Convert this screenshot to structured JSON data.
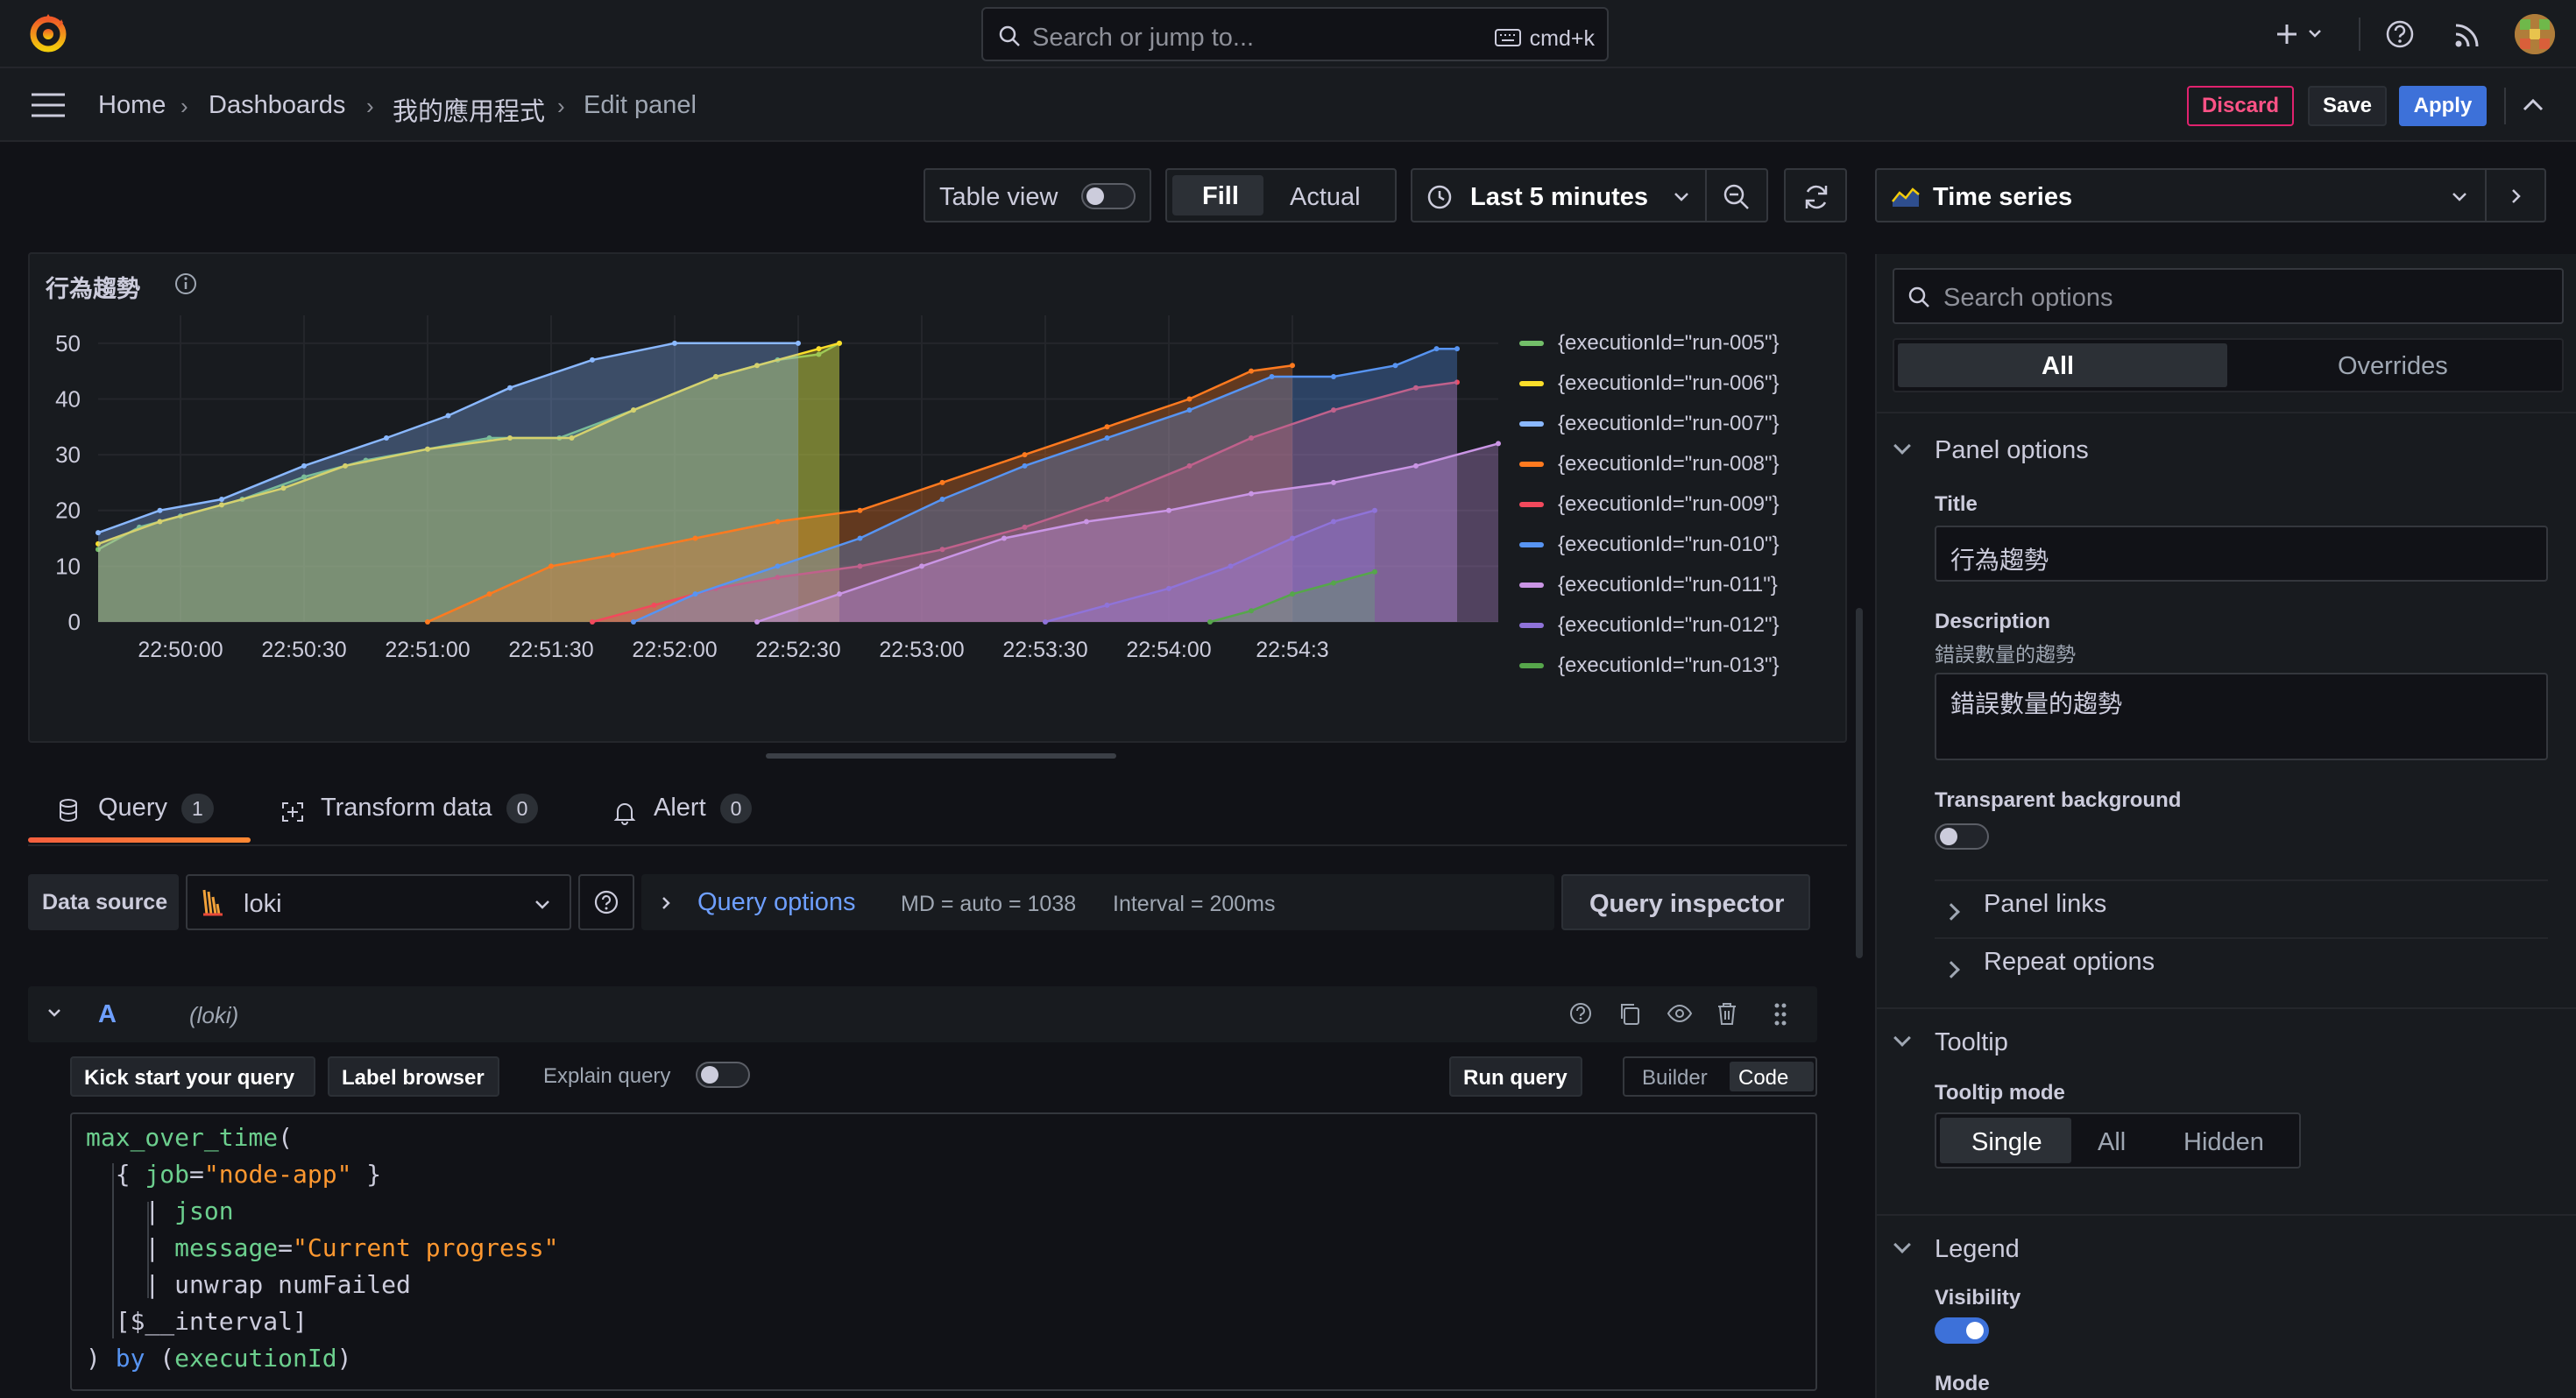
{
  "topbar": {
    "search_placeholder": "Search or jump to...",
    "search_shortcut": "cmd+k"
  },
  "breadcrumb": [
    "Home",
    "Dashboards",
    "我的應用程式",
    "Edit panel"
  ],
  "actions": {
    "discard": "Discard",
    "save": "Save",
    "apply": "Apply"
  },
  "toolbar": {
    "table_view": "Table view",
    "fill": "Fill",
    "actual": "Actual",
    "time_range": "Last 5 minutes",
    "visualization": "Time series"
  },
  "panel": {
    "title": "行為趨勢"
  },
  "chart_data": {
    "type": "area",
    "title": "行為趨勢",
    "ylim": [
      0,
      55
    ],
    "yticks": [
      "0",
      "10",
      "20",
      "30",
      "40",
      "50"
    ],
    "xticks": [
      "22:50:00",
      "22:50:30",
      "22:51:00",
      "22:51:30",
      "22:52:00",
      "22:52:30",
      "22:53:00",
      "22:53:30",
      "22:54:00",
      "22:54:3"
    ],
    "x_range_seconds_from_22_49_40": [
      0,
      290
    ],
    "series": [
      {
        "name": "{executionId=\"run-005\"}",
        "color": "#73bf69",
        "points": [
          [
            0,
            13
          ],
          [
            10,
            17
          ],
          [
            20,
            19
          ],
          [
            35,
            22
          ],
          [
            50,
            26
          ],
          [
            65,
            29
          ],
          [
            80,
            31
          ],
          [
            95,
            33
          ],
          [
            112,
            33
          ],
          [
            130,
            38
          ],
          [
            150,
            44
          ],
          [
            165,
            47
          ],
          [
            175,
            48
          ],
          [
            180,
            50
          ]
        ]
      },
      {
        "name": "{executionId=\"run-006\"}",
        "color": "#fade2a",
        "points": [
          [
            0,
            14
          ],
          [
            15,
            18
          ],
          [
            30,
            21
          ],
          [
            45,
            24
          ],
          [
            60,
            28
          ],
          [
            80,
            31
          ],
          [
            100,
            33
          ],
          [
            115,
            33
          ],
          [
            130,
            38
          ],
          [
            150,
            44
          ],
          [
            160,
            46
          ],
          [
            175,
            49
          ],
          [
            180,
            50
          ]
        ]
      },
      {
        "name": "{executionId=\"run-007\"}",
        "color": "#8ab8ff",
        "points": [
          [
            0,
            16
          ],
          [
            15,
            20
          ],
          [
            30,
            22
          ],
          [
            50,
            28
          ],
          [
            70,
            33
          ],
          [
            85,
            37
          ],
          [
            100,
            42
          ],
          [
            120,
            47
          ],
          [
            140,
            50
          ],
          [
            170,
            50
          ]
        ]
      },
      {
        "name": "{executionId=\"run-008\"}",
        "color": "#ff7a1f",
        "points": [
          [
            80,
            0
          ],
          [
            95,
            5
          ],
          [
            110,
            10
          ],
          [
            125,
            12
          ],
          [
            145,
            15
          ],
          [
            165,
            18
          ],
          [
            185,
            20
          ],
          [
            205,
            25
          ],
          [
            225,
            30
          ],
          [
            245,
            35
          ],
          [
            265,
            40
          ],
          [
            280,
            45
          ],
          [
            290,
            46
          ]
        ]
      },
      {
        "name": "{executionId=\"run-009\"}",
        "color": "#f2495c",
        "points": [
          [
            120,
            0
          ],
          [
            135,
            3
          ],
          [
            150,
            6
          ],
          [
            165,
            8
          ],
          [
            185,
            10
          ],
          [
            205,
            13
          ],
          [
            225,
            17
          ],
          [
            245,
            22
          ],
          [
            265,
            28
          ],
          [
            280,
            33
          ],
          [
            300,
            38
          ],
          [
            320,
            42
          ],
          [
            330,
            43
          ]
        ]
      },
      {
        "name": "{executionId=\"run-010\"}",
        "color": "#5794f2",
        "points": [
          [
            130,
            0
          ],
          [
            145,
            5
          ],
          [
            165,
            10
          ],
          [
            185,
            15
          ],
          [
            205,
            22
          ],
          [
            225,
            28
          ],
          [
            245,
            33
          ],
          [
            265,
            38
          ],
          [
            285,
            44
          ],
          [
            300,
            44
          ],
          [
            315,
            46
          ],
          [
            325,
            49
          ],
          [
            330,
            49
          ]
        ]
      },
      {
        "name": "{executionId=\"run-011\"}",
        "color": "#ca95e5",
        "points": [
          [
            160,
            0
          ],
          [
            180,
            5
          ],
          [
            200,
            10
          ],
          [
            220,
            15
          ],
          [
            240,
            18
          ],
          [
            260,
            20
          ],
          [
            280,
            23
          ],
          [
            300,
            25
          ],
          [
            320,
            28
          ],
          [
            340,
            32
          ],
          [
            350,
            34
          ]
        ]
      },
      {
        "name": "{executionId=\"run-012\"}",
        "color": "#8f73d9",
        "points": [
          [
            230,
            0
          ],
          [
            245,
            3
          ],
          [
            260,
            6
          ],
          [
            275,
            10
          ],
          [
            290,
            15
          ],
          [
            300,
            18
          ],
          [
            310,
            20
          ]
        ]
      },
      {
        "name": "{executionId=\"run-013\"}",
        "color": "#56a64b",
        "points": [
          [
            270,
            0
          ],
          [
            280,
            2
          ],
          [
            290,
            5
          ],
          [
            300,
            7
          ],
          [
            310,
            9
          ]
        ]
      }
    ]
  },
  "query_tabs": [
    {
      "label": "Query",
      "count": "1"
    },
    {
      "label": "Transform data",
      "count": "0"
    },
    {
      "label": "Alert",
      "count": "0"
    }
  ],
  "datasource": {
    "label": "Data source",
    "value": "loki",
    "query_options": "Query options",
    "md": "MD = auto = 1038",
    "interval": "Interval = 200ms",
    "inspector": "Query inspector"
  },
  "query_row": {
    "ref": "A",
    "ds": "(loki)",
    "kick_start": "Kick start your query",
    "label_browser": "Label browser",
    "explain": "Explain query",
    "run": "Run query",
    "builder": "Builder",
    "code": "Code"
  },
  "code_lines": [
    "max_over_time(",
    "  { job=\"node-app\" }",
    "    | json",
    "    | message=\"Current progress\"",
    "    | unwrap numFailed",
    "  [$__interval]",
    ") by (executionId)"
  ],
  "options": {
    "search_placeholder": "Search options",
    "tab_all": "All",
    "tab_overrides": "Overrides",
    "panel_options": "Panel options",
    "title_label": "Title",
    "title_value": "行為趨勢",
    "description_label": "Description",
    "description_sub": "錯誤數量的趨勢",
    "description_value": "錯誤數量的趨勢",
    "transparent_label": "Transparent background",
    "panel_links": "Panel links",
    "repeat_options": "Repeat options",
    "tooltip": "Tooltip",
    "tooltip_mode": "Tooltip mode",
    "tooltip_modes": [
      "Single",
      "All",
      "Hidden"
    ],
    "legend": "Legend",
    "visibility": "Visibility",
    "mode": "Mode"
  }
}
